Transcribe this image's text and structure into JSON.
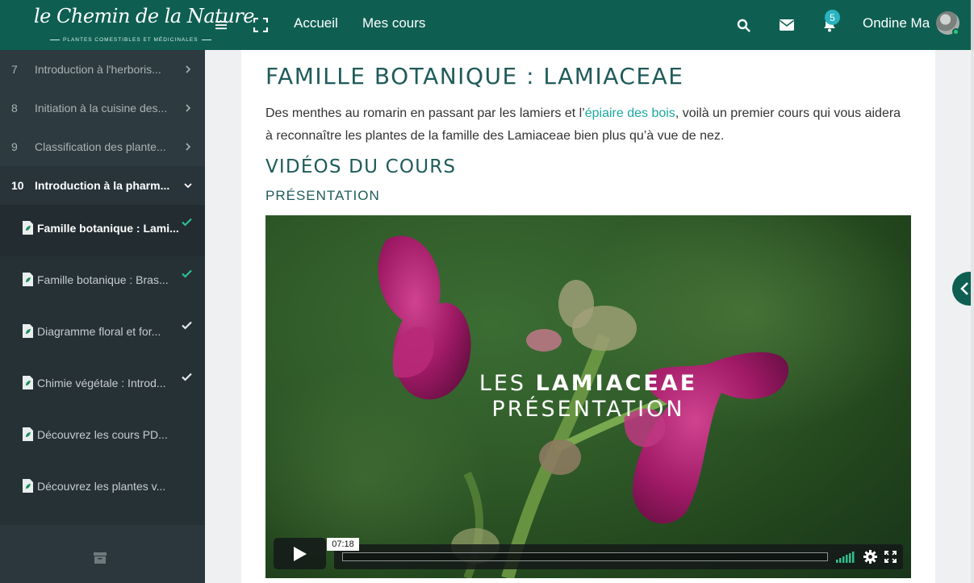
{
  "brand": {
    "logo_text": "le Chemin de la Nature",
    "logo_subtitle": "PLANTES COMESTIBLES ET MÉDICINALES"
  },
  "topbar": {
    "menu_icon": "hamburger-icon",
    "fullscreen_icon": "fullscreen-icon",
    "nav": [
      "Accueil",
      "Mes cours"
    ],
    "search_icon": "search-icon",
    "mail_icon": "envelope-icon",
    "bell_icon": "bell-icon",
    "notification_count": "5",
    "user_name": "Ondine Ma",
    "colors": {
      "bar": "#0e5f52",
      "badge": "#2ab3c0",
      "online": "#2ecc71"
    }
  },
  "sidebar": {
    "sections": [
      {
        "num": "7",
        "title": "Introduction à l'herboris...",
        "expanded": false
      },
      {
        "num": "8",
        "title": "Initiation à la cuisine des...",
        "expanded": false
      },
      {
        "num": "9",
        "title": "Classification des plante...",
        "expanded": false
      },
      {
        "num": "10",
        "title": "Introduction à la pharm...",
        "expanded": true
      }
    ],
    "lessons": [
      {
        "title": "Famille botanique : Lami...",
        "check_color": "#2fbf8f"
      },
      {
        "title": "Famille botanique : Bras...",
        "check_color": "#2fbf8f"
      },
      {
        "title": "Diagramme floral et for...",
        "check_color": "#e6eaeb"
      },
      {
        "title": "Chimie végétale : Introd...",
        "check_color": "#e6eaeb"
      },
      {
        "title": "Découvrez les cours PD...",
        "check_color": ""
      },
      {
        "title": "Découvrez les plantes v...",
        "check_color": ""
      }
    ],
    "archive_icon": "archive-icon"
  },
  "main": {
    "title": "FAMILLE BOTANIQUE : LAMIACEAE",
    "intro_before": "Des menthes au romarin en passant par les lamiers et l’",
    "intro_link": "épiaire des bois",
    "intro_after": ", voilà un premier cours qui vous aidera à reconnaître les plantes de la famille des Lamiaceae bien plus qu’à vue de nez.",
    "section_title": "VIDÉOS DU COURS",
    "subsection_title": "PRÉSENTATION",
    "heading_color": "#1f5b5a",
    "link_color": "#1ba8a0"
  },
  "video": {
    "title_line1_light": "LES ",
    "title_line1_bold": "LAMIACEAE",
    "title_line2": "PRÉSENTATION",
    "time_tooltip": "07:18",
    "progress": 0,
    "controls": [
      "play-icon",
      "volume-icon",
      "gear-icon",
      "fullscreen-icon"
    ]
  },
  "drawer_toggle_icon": "chevron-left-icon"
}
